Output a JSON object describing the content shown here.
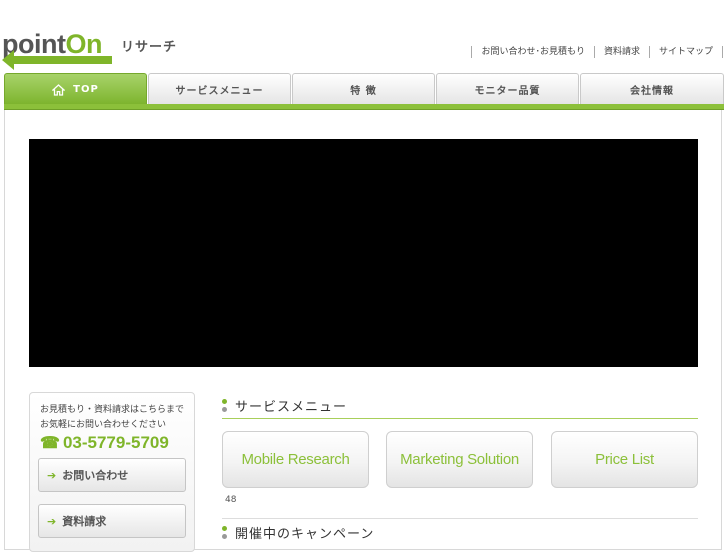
{
  "header": {
    "logo_main": "point",
    "logo_on": "On",
    "logo_sub": "リサーチ",
    "util_links": [
      "お問い合わせ･お見積もり",
      "資料請求",
      "サイトマップ"
    ]
  },
  "nav": {
    "tabs": [
      "TOP",
      "サービスメニュー",
      "特 徴",
      "モニター品質",
      "会社情報"
    ],
    "active_index": 0
  },
  "side": {
    "text_line1": "お見積もり・資料請求はこちらまで",
    "text_line2": "お気軽にお問い合わせください",
    "tel_icon": "☎",
    "tel": "03-5779-5709",
    "contact_button": "お問い合わせ",
    "docs_button": "資料請求"
  },
  "main": {
    "service_heading": "サービスメニュー",
    "service_buttons": [
      "Mobile Research",
      "Marketing Solution",
      "Price List"
    ],
    "count": "48",
    "campaign_heading": "開催中のキャンペーン"
  },
  "colors": {
    "accent": "#7fb52a",
    "nav_active": "#8cc03a"
  }
}
